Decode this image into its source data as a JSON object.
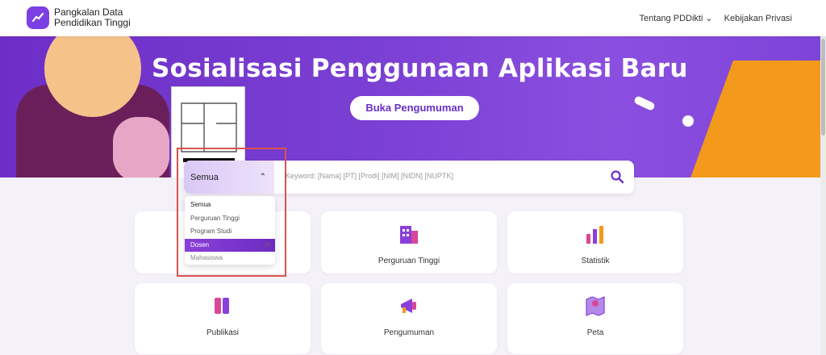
{
  "header": {
    "brand_line1": "Pangkalan Data",
    "brand_line2": "Pendidikan Tinggi",
    "nav": [
      {
        "label": "Tentang PDDikti"
      },
      {
        "label": "Kebijakan Privasi"
      }
    ]
  },
  "hero": {
    "title": "Sosialisasi Penggunaan Aplikasi Baru",
    "button_label": "Buka Pengumuman"
  },
  "search": {
    "selected_option": "Semua",
    "placeholder": "Keyword: [Nama] [PT] [Prodi] [NIM] [NIDN] [NUPTK]",
    "options": [
      "Semua",
      "Perguruan Tinggi",
      "Program Studi",
      "Dosen",
      "Mahasiswa"
    ]
  },
  "cards": [
    {
      "label": "Perguruan Tinggi",
      "icon": "building-icon"
    },
    {
      "label": "Statistik",
      "icon": "bar-chart-icon"
    },
    {
      "label": "Publikasi",
      "icon": "book-icon"
    },
    {
      "label": "Pengumuman",
      "icon": "megaphone-icon"
    },
    {
      "label": "Peta",
      "icon": "map-icon"
    }
  ],
  "colors": {
    "accent": "#7b3fe4",
    "highlight_outline": "#d9534f",
    "hero_orange": "#f39a1c"
  }
}
